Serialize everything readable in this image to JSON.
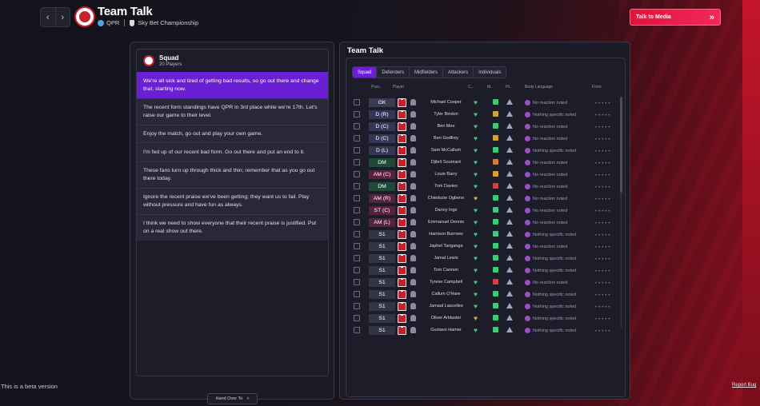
{
  "header": {
    "title": "Team Talk",
    "opponent": "QPR",
    "competition": "Sky Bet Championship",
    "media_button": "Talk to Media"
  },
  "squad_panel": {
    "title": "Squad",
    "count": "20 Players",
    "options": [
      "We're all sick and tired of getting bad results, so go out there and change that, starting now.",
      "The recent form standings have QPR in 3rd place while we're 17th. Let's raise our game to their level.",
      "Enjoy the match, go out and play your own game.",
      "I'm fed up of our recent bad form. Go out there and put an end to it.",
      "These fans turn up through thick and thin; remember that as you go out there today.",
      "Ignore the recent praise we've been getting; they want us to fail. Play without pressure and have fun as always.",
      "I think we need to show everyone that their recent praise is justified. Put on a real show out there."
    ],
    "selected_index": 0,
    "hand_over": "Hand Over To"
  },
  "team_talk_panel": {
    "title": "Team Talk",
    "tabs": [
      "Squad",
      "Defenders",
      "Midfielders",
      "Attackers",
      "Individuals"
    ],
    "active_tab": 0,
    "columns": [
      "Posi...",
      "Player",
      "C...",
      "M...",
      "Hi...",
      "Body Language",
      "Form"
    ],
    "players": [
      {
        "pos": "GK",
        "name": "Michael Cooper",
        "reaction": "No reaction noted",
        "heart": "#3ec878",
        "morale": "#3ec878"
      },
      {
        "pos": "D (R)",
        "name": "Tyler Bindon",
        "reaction": "Nothing specific noted",
        "heart": "#3ec878",
        "morale": "#d9a030"
      },
      {
        "pos": "D (C)",
        "name": "Ben Mee",
        "reaction": "No reaction noted",
        "heart": "#3ec878",
        "morale": "#3ec878"
      },
      {
        "pos": "D (C)",
        "name": "Ben Godfrey",
        "reaction": "No reaction noted",
        "heart": "#3ec878",
        "morale": "#d9a030"
      },
      {
        "pos": "D (L)",
        "name": "Sam McCallum",
        "reaction": "Nothing specific noted",
        "heart": "#3ec878",
        "morale": "#3ec878"
      },
      {
        "pos": "DM",
        "name": "Djibril Soumaré",
        "reaction": "No reaction noted",
        "heart": "#3ec878",
        "morale": "#e07a30"
      },
      {
        "pos": "AM (C)",
        "name": "Louie Barry",
        "reaction": "No reaction noted",
        "heart": "#3ec878",
        "morale": "#d9a030"
      },
      {
        "pos": "DM",
        "name": "Tom Davies",
        "reaction": "No reaction noted",
        "heart": "#3ec878",
        "morale": "#d64040"
      },
      {
        "pos": "AM (R)",
        "name": "Chiedozie Ogbene",
        "reaction": "No reaction noted",
        "heart": "#d9b030",
        "morale": "#3ec878"
      },
      {
        "pos": "ST (C)",
        "name": "Danny Ings",
        "reaction": "No reaction noted",
        "heart": "#3ec878",
        "morale": "#3ec878"
      },
      {
        "pos": "AM (L)",
        "name": "Emmanuel Dennis",
        "reaction": "No reaction noted",
        "heart": "#3ec878",
        "morale": "#3ec878"
      },
      {
        "pos": "S1",
        "name": "Harrison Burrows",
        "reaction": "Nothing specific noted",
        "heart": "#3ec878",
        "morale": "#3ec878"
      },
      {
        "pos": "S1",
        "name": "Japhet Tanganga",
        "reaction": "No reaction noted",
        "heart": "#3ec878",
        "morale": "#3ec878"
      },
      {
        "pos": "S1",
        "name": "Jamal Lewis",
        "reaction": "Nothing specific noted",
        "heart": "#3ec878",
        "morale": "#3ec878"
      },
      {
        "pos": "S1",
        "name": "Tom Cannon",
        "reaction": "Nothing specific noted",
        "heart": "#3ec878",
        "morale": "#3ec878"
      },
      {
        "pos": "S1",
        "name": "Tyrese Campbell",
        "reaction": "No reaction noted",
        "heart": "#3ec878",
        "morale": "#d64040"
      },
      {
        "pos": "S1",
        "name": "Callum O'Hare",
        "reaction": "Nothing specific noted",
        "heart": "#3ec878",
        "morale": "#3ec878"
      },
      {
        "pos": "S1",
        "name": "Jamaal Lascelles",
        "reaction": "Nothing specific noted",
        "heart": "#3ec878",
        "morale": "#3ec878"
      },
      {
        "pos": "S1",
        "name": "Oliver Arblaster",
        "reaction": "Nothing specific noted",
        "heart": "#d9b030",
        "morale": "#3ec878"
      },
      {
        "pos": "S1",
        "name": "Gustavo Hamer",
        "reaction": "Nothing specific noted",
        "heart": "#3ec878",
        "morale": "#3ec878"
      }
    ]
  },
  "footer": {
    "beta": "This is a beta version",
    "report": "Report Bug"
  },
  "colors": {
    "accent": "#6b1fd4",
    "media_button": "#e0143a",
    "pos_gk": "#3a3a52",
    "pos_def": "#35355a",
    "pos_mid": "#1f4a3a",
    "pos_att": "#5a2040",
    "pos_sub": "#343448"
  }
}
